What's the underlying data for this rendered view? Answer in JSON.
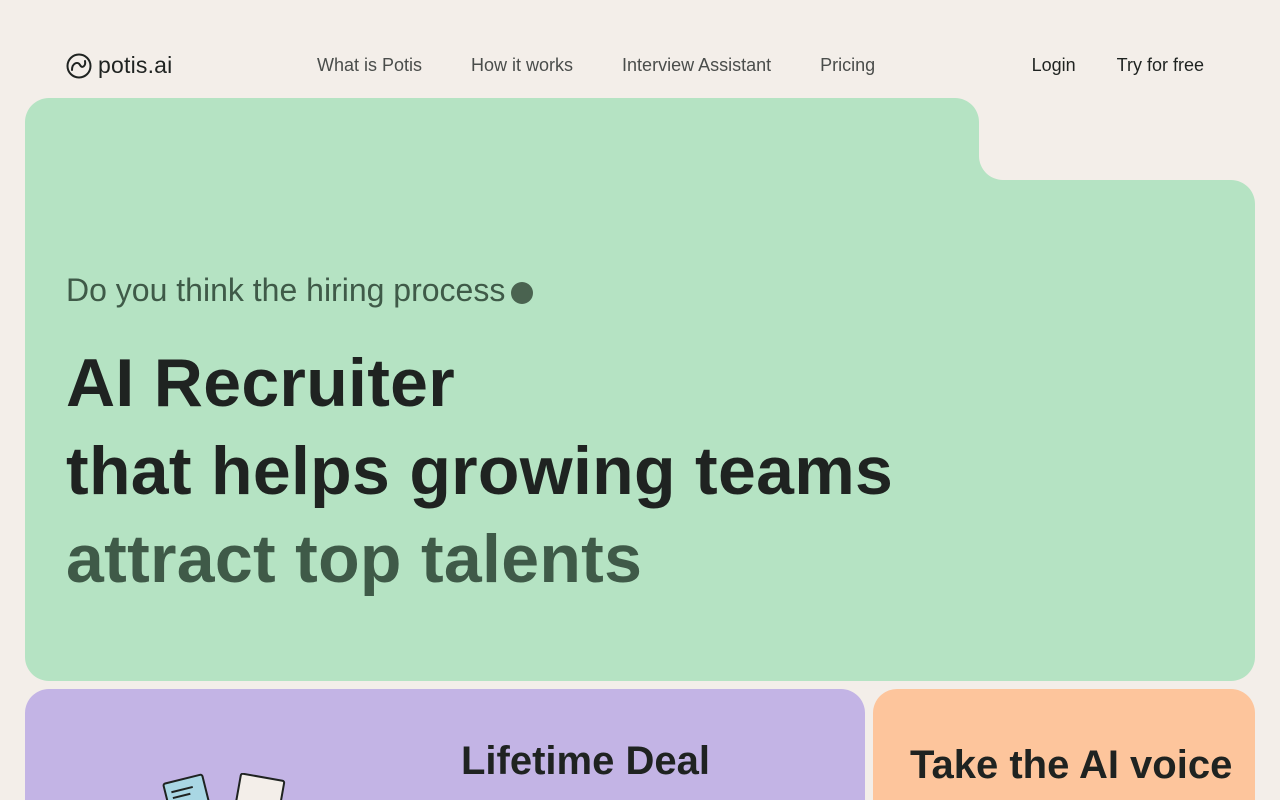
{
  "brand": {
    "name": "potis.ai",
    "logo_icon": "potis-swirl-icon"
  },
  "nav": {
    "items": [
      {
        "label": "What is Potis"
      },
      {
        "label": "How it works"
      },
      {
        "label": "Interview Assistant"
      },
      {
        "label": "Pricing"
      }
    ]
  },
  "header": {
    "login_label": "Login",
    "trial_label": "Try for free"
  },
  "hero": {
    "question": "Do you think the hiring process",
    "title_line1": "AI Recruiter",
    "title_line2": "that helps growing teams",
    "title_line3": "attract top talents"
  },
  "cards": {
    "deal_title": "Lifetime Deal",
    "voice_title": "Take the AI voice"
  },
  "colors": {
    "page_bg": "#f3eee9",
    "hero_bg": "#b5e3c3",
    "hero_accent": "#3f5a48",
    "deal_bg": "#c3b4e5",
    "voice_bg": "#fdc59c",
    "text": "#1f2321"
  }
}
